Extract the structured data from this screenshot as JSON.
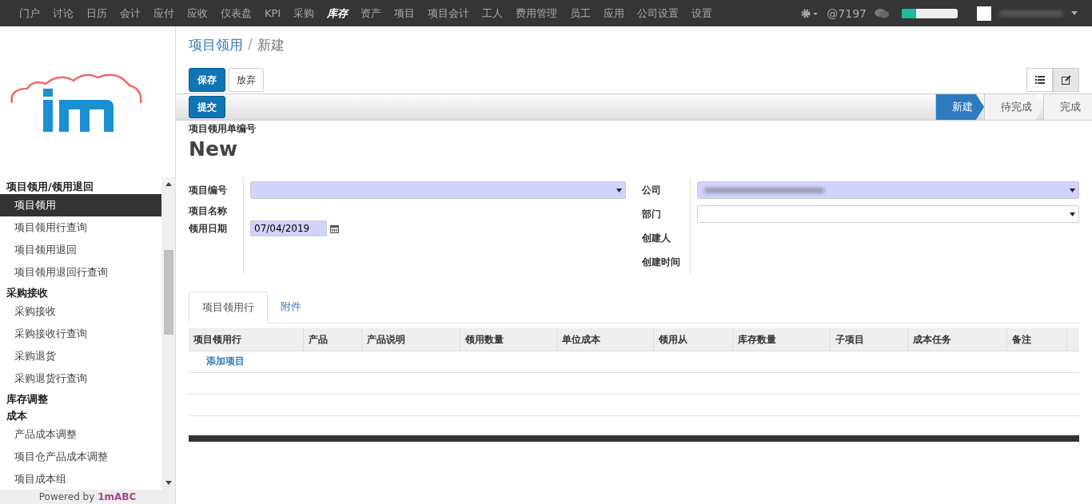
{
  "top_menu": [
    {
      "label": "门户",
      "selected": false
    },
    {
      "label": "讨论",
      "selected": false
    },
    {
      "label": "日历",
      "selected": false
    },
    {
      "label": "会计",
      "selected": false
    },
    {
      "label": "应付",
      "selected": false
    },
    {
      "label": "应收",
      "selected": false
    },
    {
      "label": "仪表盘",
      "selected": false
    },
    {
      "label": "KPI",
      "selected": false
    },
    {
      "label": "采购",
      "selected": false
    },
    {
      "label": "库存",
      "selected": true
    },
    {
      "label": "资产",
      "selected": false
    },
    {
      "label": "项目",
      "selected": false
    },
    {
      "label": "项目会计",
      "selected": false
    },
    {
      "label": "工人",
      "selected": false
    },
    {
      "label": "费用管理",
      "selected": false
    },
    {
      "label": "员工",
      "selected": false
    },
    {
      "label": "应用",
      "selected": false
    },
    {
      "label": "公司设置",
      "selected": false
    },
    {
      "label": "设置",
      "selected": false
    }
  ],
  "systray": {
    "mentions": "@7197",
    "progress": {
      "level": 0.25
    }
  },
  "sidebar": {
    "sections": [
      {
        "title": "项目领用/领用退回",
        "items": [
          {
            "label": "项目领用",
            "selected": true
          },
          {
            "label": "项目领用行查询",
            "selected": false
          },
          {
            "label": "项目领用退回",
            "selected": false
          },
          {
            "label": "项目领用退回行查询",
            "selected": false
          }
        ]
      },
      {
        "title": "采购接收",
        "items": [
          {
            "label": "采购接收",
            "selected": false
          },
          {
            "label": "采购接收行查询",
            "selected": false
          },
          {
            "label": "采购退货",
            "selected": false
          },
          {
            "label": "采购退货行查询",
            "selected": false
          }
        ]
      },
      {
        "title": "库存调整"
      },
      {
        "title": "成本",
        "items": [
          {
            "label": "产品成本调整",
            "selected": false
          },
          {
            "label": "项目仓产品成本调整",
            "selected": false
          },
          {
            "label": "项目成本组",
            "selected": false
          }
        ]
      }
    ],
    "footer": {
      "prefix": "Powered by",
      "brand": "1mABC"
    }
  },
  "breadcrumb": [
    "项目领用",
    "/",
    "新建"
  ],
  "buttons": [
    "保存",
    "放弃"
  ],
  "view_switch": [
    {
      "kind": "list",
      "selected": false
    },
    {
      "kind": "form",
      "selected": true
    }
  ],
  "statusbar": {
    "action": "提交",
    "stages": [
      {
        "label": "新建",
        "selected": true
      },
      {
        "label": "待完成",
        "selected": false
      },
      {
        "label": "完成",
        "selected": false
      }
    ]
  },
  "form": {
    "number_label": "项目领用单编号",
    "number": "New",
    "left": [
      {
        "label": "项目编号",
        "kind": "select",
        "required": true
      },
      {
        "label": "项目名称",
        "kind": "empty"
      },
      {
        "label": "领用日期",
        "kind": "date",
        "value": "07/04/2019",
        "required": true
      }
    ],
    "right": [
      {
        "label": "公司",
        "kind": "select",
        "required": true,
        "blurred": true
      },
      {
        "label": "部门",
        "kind": "select",
        "required": false
      },
      {
        "label": "创建人",
        "kind": "empty"
      },
      {
        "label": "创建时间",
        "kind": "empty"
      }
    ]
  },
  "tabs": [
    {
      "label": "项目领用行",
      "selected": true
    },
    {
      "label": "附件",
      "selected": false
    }
  ],
  "table": {
    "columns": [
      "项目领用行",
      "产品",
      "产品说明",
      "领用数量",
      "单位成本",
      "领用从",
      "库存数量",
      "子项目",
      "成本任务",
      "备注"
    ],
    "add_link": "添加项目"
  }
}
